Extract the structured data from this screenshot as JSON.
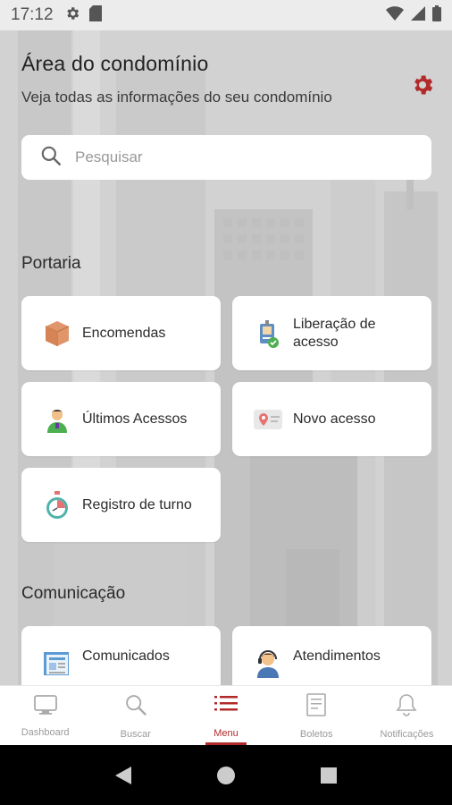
{
  "status_bar": {
    "time": "17:12"
  },
  "header": {
    "title": "Área do condomínio",
    "subtitle": "Veja todas as informações do seu condomínio"
  },
  "search": {
    "placeholder": "Pesquisar"
  },
  "sections": {
    "portaria": {
      "title": "Portaria",
      "items": [
        {
          "label": "Encomendas",
          "icon": "package-icon"
        },
        {
          "label": "Liberação de acesso",
          "icon": "badge-check-icon"
        },
        {
          "label": "Últimos Acessos",
          "icon": "person-icon"
        },
        {
          "label": "Novo acesso",
          "icon": "location-card-icon"
        },
        {
          "label": "Registro de turno",
          "icon": "stopwatch-icon"
        }
      ]
    },
    "comunicacao": {
      "title": "Comunicação",
      "items": [
        {
          "label": "Comunicados",
          "icon": "newspaper-icon"
        },
        {
          "label": "Atendimentos",
          "icon": "support-agent-icon"
        }
      ]
    }
  },
  "bottom_nav": [
    {
      "label": "Dashboard",
      "icon": "monitor-icon"
    },
    {
      "label": "Buscar",
      "icon": "search-icon"
    },
    {
      "label": "Menu",
      "icon": "menu-list-icon",
      "active": true
    },
    {
      "label": "Boletos",
      "icon": "invoice-icon"
    },
    {
      "label": "Notificações",
      "icon": "bell-icon"
    }
  ],
  "colors": {
    "accent": "#b22a2a",
    "background": "#d4d4d4",
    "card": "#ffffff"
  }
}
